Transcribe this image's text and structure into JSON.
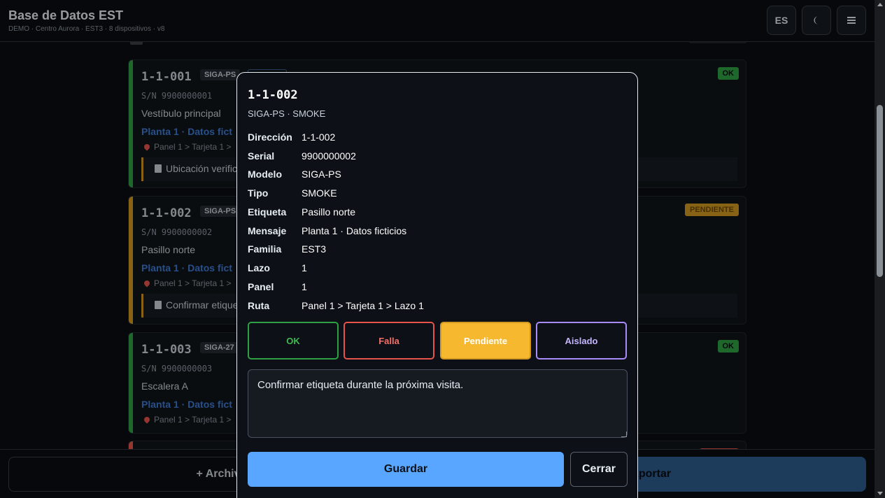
{
  "header": {
    "title": "Base de Datos EST",
    "subtitle": "DEMO · Centro Aurora · EST3 · 8 dispositivos · v8",
    "lang_label": "ES",
    "theme_icon": "moon-icon",
    "menu_icon": "hamburger-menu-icon"
  },
  "colors": {
    "ok": "#2ea043",
    "pending": "#d29922",
    "fault": "#e5534b",
    "isolated": "#a78bfa",
    "accent": "#58a6ff"
  },
  "cards": [
    {
      "address": "1-1-001",
      "model": "SIGA-PS",
      "serial": "S/N 9900000001",
      "label": "Vestíbulo principal",
      "message": "Planta 1 · Datos fict",
      "path": "Panel 1 > Tarjeta 1 >",
      "note": "Ubicación verific",
      "status": "OK"
    },
    {
      "address": "1-1-002",
      "model": "SIGA-PS",
      "serial": "S/N 9900000002",
      "label": "Pasillo norte",
      "message": "Planta 1 · Datos fict",
      "path": "Panel 1 > Tarjeta 1 >",
      "note": "Confirmar etique",
      "status": "PENDIENTE"
    },
    {
      "address": "1-1-003",
      "model": "SIGA-27",
      "serial": "S/N 9900000003",
      "label": "Escalera A",
      "message": "Planta 1 · Datos fict",
      "path": "Panel 1 > Tarjeta 1 >",
      "status": "OK"
    }
  ],
  "bottom": {
    "archive_label": "+ Archiv",
    "export_label": "xportar"
  },
  "modal": {
    "title": "1-1-002",
    "subtitle": "SIGA-PS · SMOKE",
    "fields": [
      {
        "key": "Dirección",
        "value": "1-1-002"
      },
      {
        "key": "Serial",
        "value": "9900000002"
      },
      {
        "key": "Modelo",
        "value": "SIGA-PS"
      },
      {
        "key": "Tipo",
        "value": "SMOKE"
      },
      {
        "key": "Etiqueta",
        "value": "Pasillo norte"
      },
      {
        "key": "Mensaje",
        "value": "Planta 1 · Datos ficticios"
      },
      {
        "key": "Familia",
        "value": "EST3"
      },
      {
        "key": "Lazo",
        "value": "1"
      },
      {
        "key": "Panel",
        "value": "1"
      },
      {
        "key": "Ruta",
        "value": "Panel 1 > Tarjeta 1 > Lazo 1"
      }
    ],
    "status_buttons": {
      "ok": "OK",
      "fault": "Falla",
      "pending": "Pendiente",
      "isolated": "Aislado"
    },
    "selected_status": "Pendiente",
    "notes_value": "Confirmar etiqueta durante la próxima visita.",
    "save_label": "Guardar",
    "close_label": "Cerrar"
  }
}
